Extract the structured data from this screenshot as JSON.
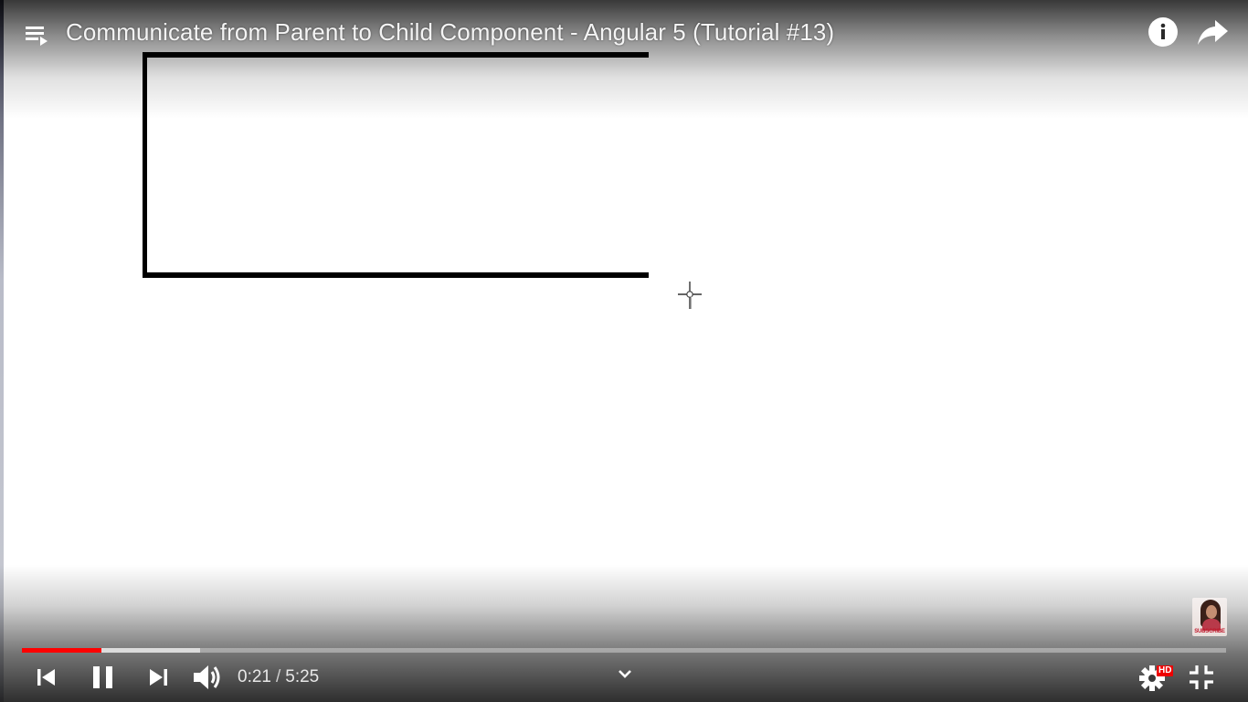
{
  "player": {
    "title": "Communicate from Parent to Child Component - Angular 5 (Tutorial #13)",
    "progress": {
      "played_fraction": 0.066,
      "loaded_fraction": 0.148,
      "played_color": "#ff0000"
    },
    "time": {
      "current": "0:21",
      "separator": "/",
      "duration": "5:25"
    },
    "hd_badge": "HD",
    "branding_watermark": "SUBSCRIBE"
  },
  "icons": {
    "top_left": "playlist-icon",
    "top_right": [
      "info-icon",
      "share-icon"
    ],
    "controls": [
      "previous-icon",
      "pause-icon",
      "next-icon",
      "volume-icon",
      "chevron-down-icon",
      "settings-icon",
      "exit-fullscreen-icon"
    ]
  },
  "video_content": {
    "description_free": true
  }
}
